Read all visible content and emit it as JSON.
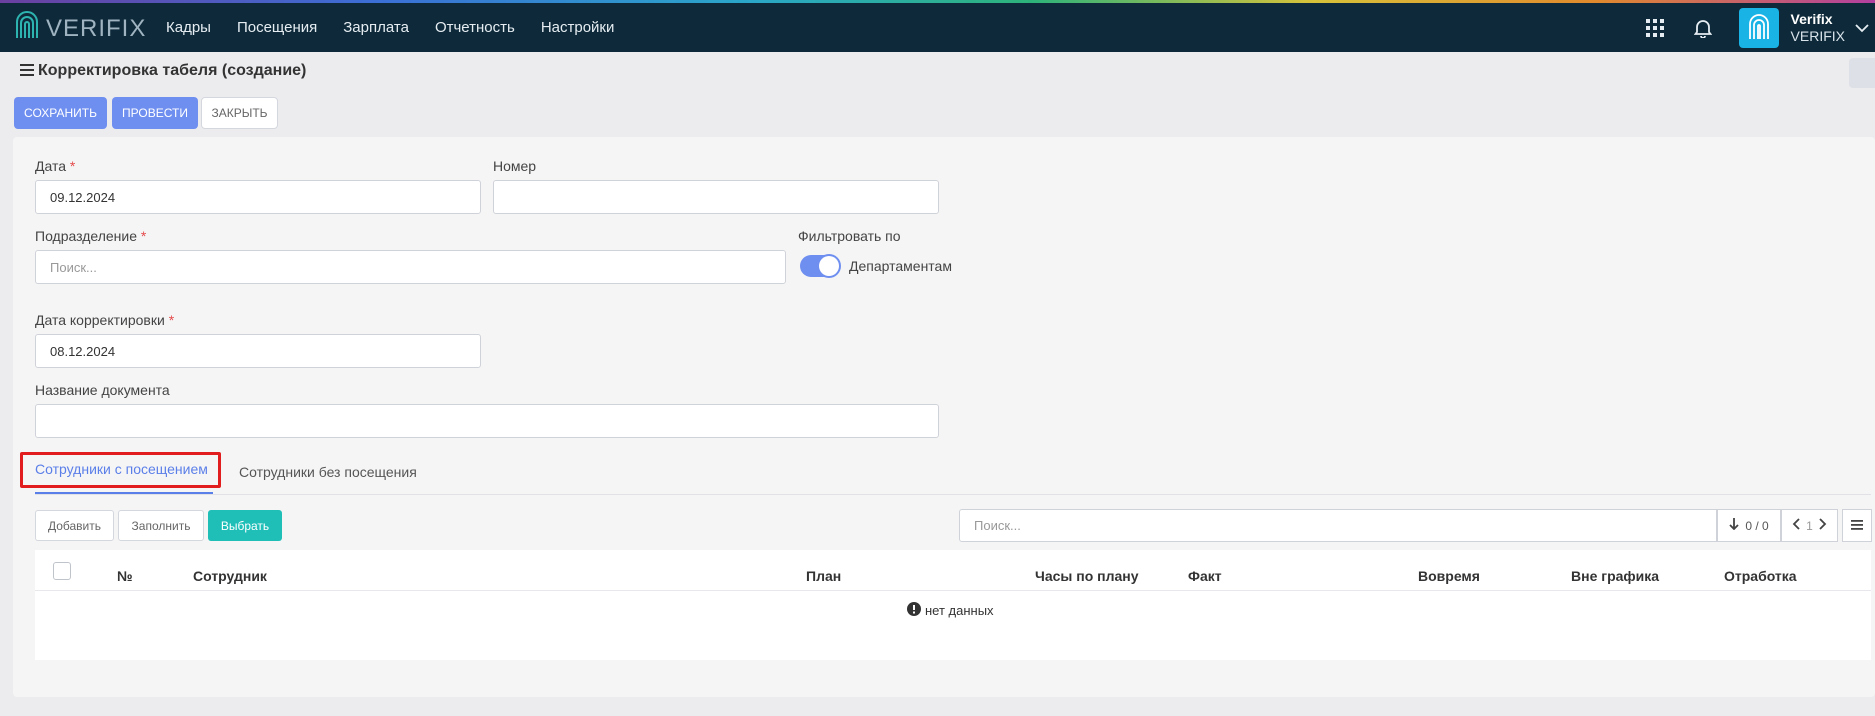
{
  "topbar": {
    "logo_text": "VERIFIX",
    "nav": [
      "Кадры",
      "Посещения",
      "Зарплата",
      "Отчетность",
      "Настройки"
    ],
    "user_name": "Verifix",
    "user_org": "VERIFIX"
  },
  "page": {
    "title": "Корректировка табеля (создание)"
  },
  "toolbar": {
    "save": "СОХРАНИТЬ",
    "post": "ПРОВЕСТИ",
    "close": "ЗАКРЫТЬ"
  },
  "form": {
    "date_label": "Дата",
    "date_value": "09.12.2024",
    "number_label": "Номер",
    "number_value": "",
    "division_label": "Подразделение",
    "division_placeholder": "Поиск...",
    "filter_label": "Фильтровать по",
    "filter_value": "Департаментам",
    "corr_date_label": "Дата корректировки",
    "corr_date_value": "08.12.2024",
    "doc_name_label": "Название документа",
    "doc_name_value": "",
    "required_mark": "*"
  },
  "tabs": [
    {
      "label": "Сотрудники с посещением",
      "active": true
    },
    {
      "label": "Сотрудники без посещения",
      "active": false
    }
  ],
  "subtoolbar": {
    "add": "Добавить",
    "fill": "Заполнить",
    "select": "Выбрать",
    "search_placeholder": "Поиск...",
    "count": "0 / 0",
    "page": "1"
  },
  "table": {
    "columns": [
      "№",
      "Сотрудник",
      "План",
      "Часы по плану",
      "Факт",
      "Вовремя",
      "Вне графика",
      "Отработка"
    ],
    "empty_text": "нет данных"
  },
  "colors": {
    "topbar": "#0e2a3a",
    "primary": "#6f8ff0",
    "teal": "#1fbfb8",
    "tab_active": "#5b7fe8",
    "highlight": "#e11d1d"
  }
}
